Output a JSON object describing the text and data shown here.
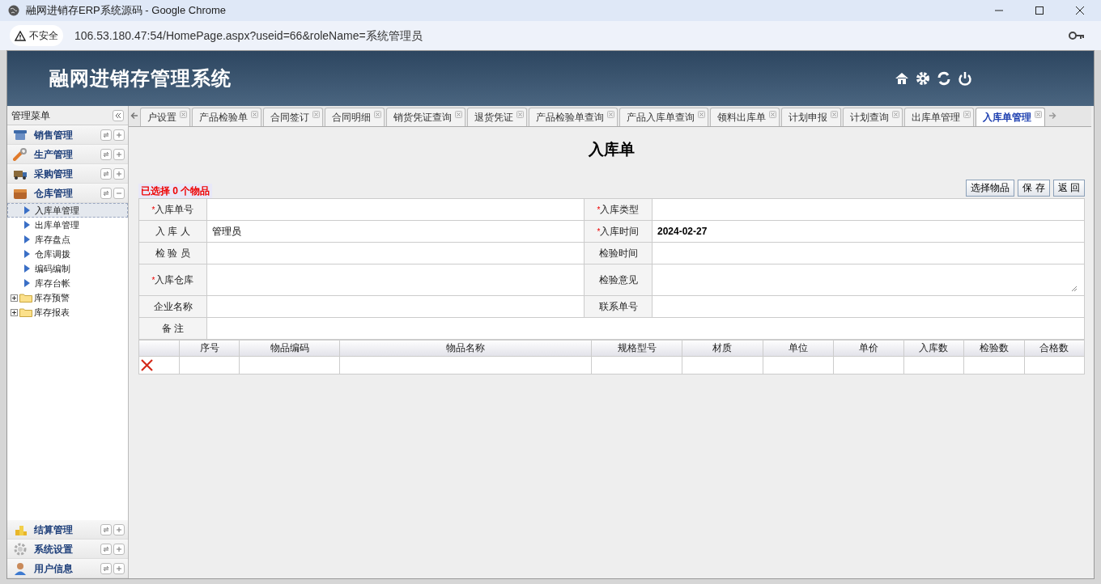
{
  "window": {
    "title": "融网进销存ERP系统源码 - Google Chrome"
  },
  "address_bar": {
    "security_label": "不安全",
    "url": "106.53.180.47:54/HomePage.aspx?useid=66&roleName=系统管理员"
  },
  "header": {
    "title": "融网进销存管理系统"
  },
  "sidebar": {
    "title": "管理菜单",
    "top_groups": [
      {
        "label": "销售管理",
        "expanded": false
      },
      {
        "label": "生产管理",
        "expanded": false
      },
      {
        "label": "采购管理",
        "expanded": false
      },
      {
        "label": "仓库管理",
        "expanded": true,
        "items": [
          {
            "label": "入库单管理",
            "kind": "page",
            "selected": true
          },
          {
            "label": "出库单管理",
            "kind": "page",
            "selected": false
          },
          {
            "label": "库存盘点",
            "kind": "page",
            "selected": false
          },
          {
            "label": "仓库调拨",
            "kind": "page",
            "selected": false
          },
          {
            "label": "编码编制",
            "kind": "page",
            "selected": false
          },
          {
            "label": "库存台帐",
            "kind": "page",
            "selected": false
          },
          {
            "label": "库存预警",
            "kind": "folder",
            "selected": false
          },
          {
            "label": "库存报表",
            "kind": "folder",
            "selected": false
          }
        ]
      }
    ],
    "bottom_groups": [
      {
        "label": "结算管理",
        "expanded": false
      },
      {
        "label": "系统设置",
        "expanded": false
      },
      {
        "label": "用户信息",
        "expanded": false
      }
    ]
  },
  "tabs": [
    {
      "label": "户设置",
      "selected": false
    },
    {
      "label": "产品检验单",
      "selected": false
    },
    {
      "label": "合同签订",
      "selected": false
    },
    {
      "label": "合同明细",
      "selected": false
    },
    {
      "label": "销货凭证查询",
      "selected": false
    },
    {
      "label": "退货凭证",
      "selected": false
    },
    {
      "label": "产品检验单查询",
      "selected": false
    },
    {
      "label": "产品入库单查询",
      "selected": false
    },
    {
      "label": "领料出库单",
      "selected": false
    },
    {
      "label": "计划申报",
      "selected": false
    },
    {
      "label": "计划查询",
      "selected": false
    },
    {
      "label": "出库单管理",
      "selected": false
    },
    {
      "label": "入库单管理",
      "selected": true
    }
  ],
  "page": {
    "title": "入库单",
    "selection_status": "已选择 0 个物品",
    "buttons": [
      "选择物品",
      "保 存",
      "返 回"
    ],
    "form_rows": [
      [
        {
          "label": "入库单号",
          "required_mark": "*",
          "kind": "text"
        },
        {
          "label": "入库类型",
          "required_mark": "*",
          "kind": "text"
        }
      ],
      [
        {
          "label": "入 库 人",
          "kind": "text",
          "value": "管理员"
        },
        {
          "label": "入库时间",
          "required_mark": "*",
          "kind": "date",
          "value": "2024-02-27"
        }
      ],
      [
        {
          "label": "检 验 员",
          "kind": "text"
        },
        {
          "label": "检验时间",
          "kind": "text"
        }
      ],
      [
        {
          "label": "入库仓库",
          "required_mark": "*",
          "kind": "text"
        },
        {
          "label": "检验意见",
          "kind": "textarea"
        }
      ],
      [
        {
          "label": "企业名称",
          "kind": "text"
        },
        {
          "label": "联系单号",
          "kind": "text"
        }
      ],
      [
        {
          "label": "备 注",
          "kind": "text"
        }
      ]
    ],
    "items_table": {
      "columns": [
        "序号",
        "物品编码",
        "物品名称",
        "规格型号",
        "材质",
        "单位",
        "单价",
        "入库数",
        "检验数",
        "合格数"
      ]
    }
  }
}
